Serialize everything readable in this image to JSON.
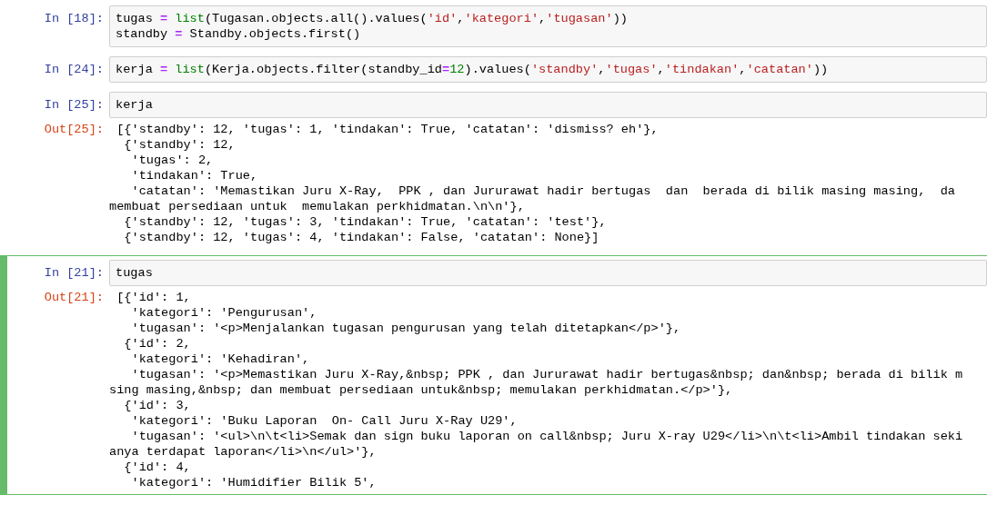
{
  "cells": [
    {
      "selected": false,
      "prompt": "In [18]:",
      "code": [
        [
          {
            "kind": "name",
            "text": "tugas "
          },
          {
            "kind": "op",
            "text": "="
          },
          {
            "kind": "builtin",
            "text": " list"
          },
          {
            "kind": "name",
            "text": "(Tugasan.objects.all().values("
          },
          {
            "kind": "string",
            "text": "'id'"
          },
          {
            "kind": "name",
            "text": ","
          },
          {
            "kind": "string",
            "text": "'kategori'"
          },
          {
            "kind": "name",
            "text": ","
          },
          {
            "kind": "string",
            "text": "'tugasan'"
          },
          {
            "kind": "name",
            "text": "))"
          }
        ],
        [
          {
            "kind": "name",
            "text": "standby "
          },
          {
            "kind": "op",
            "text": "="
          },
          {
            "kind": "name",
            "text": " Standby.objects.first()"
          }
        ]
      ]
    },
    {
      "selected": false,
      "prompt": "In [24]:",
      "code": [
        [
          {
            "kind": "name",
            "text": "kerja "
          },
          {
            "kind": "op",
            "text": "="
          },
          {
            "kind": "builtin",
            "text": " list"
          },
          {
            "kind": "name",
            "text": "(Kerja.objects.filter(standby_id"
          },
          {
            "kind": "op",
            "text": "="
          },
          {
            "kind": "number",
            "text": "12"
          },
          {
            "kind": "name",
            "text": ").values("
          },
          {
            "kind": "string",
            "text": "'standby'"
          },
          {
            "kind": "name",
            "text": ","
          },
          {
            "kind": "string",
            "text": "'tugas'"
          },
          {
            "kind": "name",
            "text": ","
          },
          {
            "kind": "string",
            "text": "'tindakan'"
          },
          {
            "kind": "name",
            "text": ","
          },
          {
            "kind": "string",
            "text": "'catatan'"
          },
          {
            "kind": "name",
            "text": "))"
          }
        ]
      ]
    },
    {
      "selected": false,
      "prompt": "In [25]:",
      "code": [
        [
          {
            "kind": "name",
            "text": "kerja"
          }
        ]
      ],
      "output_prompt": "Out[25]:",
      "output": [
        " [{'standby': 12, 'tugas': 1, 'tindakan': True, 'catatan': 'dismiss? eh'},",
        "  {'standby': 12,",
        "   'tugas': 2,",
        "   'tindakan': True,",
        "   'catatan': 'Memastikan Juru X-Ray,  PPK , dan Jururawat hadir bertugas  dan  berada di bilik masing masing,  da",
        "membuat persediaan untuk  memulakan perkhidmatan.\\n\\n'},",
        "  {'standby': 12, 'tugas': 3, 'tindakan': True, 'catatan': 'test'},",
        "  {'standby': 12, 'tugas': 4, 'tindakan': False, 'catatan': None}]"
      ]
    },
    {
      "selected": true,
      "prompt": "In [21]:",
      "code": [
        [
          {
            "kind": "name",
            "text": "tugas"
          }
        ]
      ],
      "output_prompt": "Out[21]:",
      "output": [
        " [{'id': 1,",
        "   'kategori': 'Pengurusan',",
        "   'tugasan': '<p>Menjalankan tugasan pengurusan yang telah ditetapkan</p>'},",
        "  {'id': 2,",
        "   'kategori': 'Kehadiran',",
        "   'tugasan': '<p>Memastikan Juru X-Ray,&nbsp; PPK , dan Jururawat hadir bertugas&nbsp; dan&nbsp; berada di bilik m",
        "sing masing,&nbsp; dan membuat persediaan untuk&nbsp; memulakan perkhidmatan.</p>'},",
        "  {'id': 3,",
        "   'kategori': 'Buku Laporan  On- Call Juru X-Ray U29',",
        "   'tugasan': '<ul>\\n\\t<li>Semak dan sign buku laporan on call&nbsp; Juru X-ray U29</li>\\n\\t<li>Ambil tindakan seki",
        "anya terdapat laporan</li>\\n</ul>'},",
        "  {'id': 4,",
        "   'kategori': 'Humidifier Bilik 5',"
      ]
    }
  ]
}
